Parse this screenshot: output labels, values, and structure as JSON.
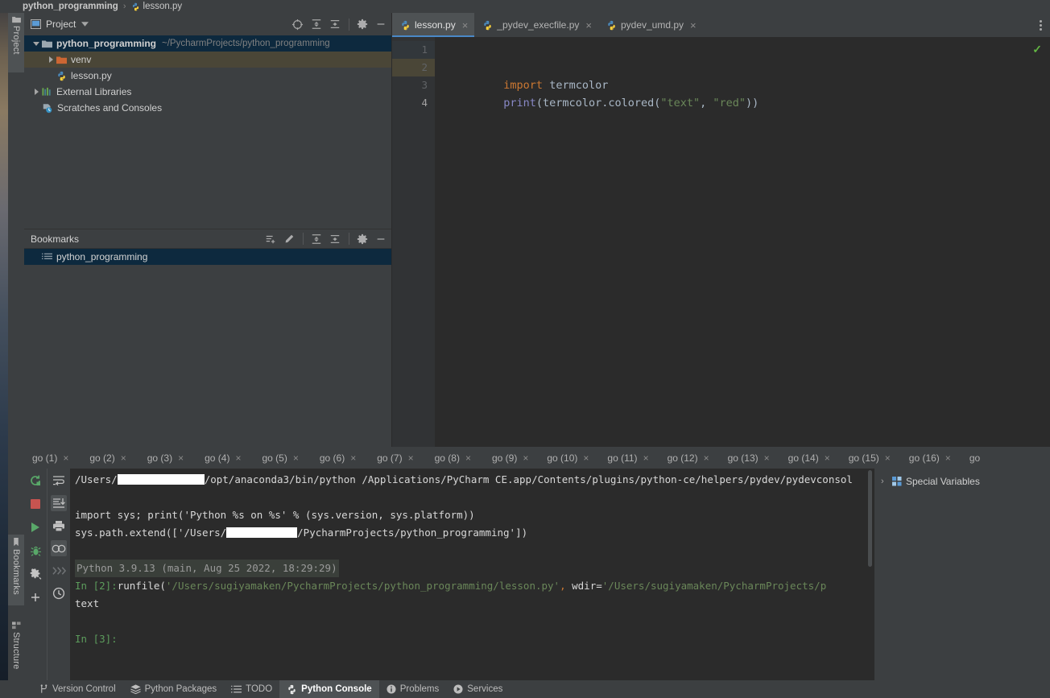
{
  "window": {
    "breadcrumb": {
      "project": "python_programming",
      "separator": "›",
      "file": "lesson.py"
    }
  },
  "left_rail": {
    "items": [
      {
        "label": "Project",
        "icon": "folder-icon",
        "active": true
      },
      {
        "label": "Bookmarks",
        "icon": "bookmark-icon",
        "active": true
      },
      {
        "label": "Structure",
        "icon": "structure-icon",
        "active": false
      }
    ]
  },
  "project_panel": {
    "title": "Project",
    "dropdown_icon": "chevron-down-icon",
    "toolbar_icons": [
      "locate-icon",
      "expand-all-icon",
      "collapse-all-icon",
      "gear-icon",
      "hide-icon"
    ],
    "tree": [
      {
        "name": "python_programming",
        "path": "~/PycharmProjects/python_programming",
        "icon": "folder-icon",
        "expanded": true,
        "selected": "blue",
        "depth": 0
      },
      {
        "name": "venv",
        "path": "",
        "icon": "venv-folder-icon",
        "expanded": false,
        "selected": "olive",
        "depth": 1
      },
      {
        "name": "lesson.py",
        "path": "",
        "icon": "python-file-icon",
        "expanded": null,
        "selected": "",
        "depth": 1
      },
      {
        "name": "External Libraries",
        "path": "",
        "icon": "libraries-icon",
        "expanded": false,
        "selected": "",
        "depth": 0
      },
      {
        "name": "Scratches and Consoles",
        "path": "",
        "icon": "scratches-icon",
        "expanded": null,
        "selected": "",
        "depth": 0
      }
    ]
  },
  "bookmarks_panel": {
    "title": "Bookmarks",
    "toolbar_icons": [
      "add-bookmark-icon",
      "edit-icon",
      "expand-all-icon",
      "collapse-all-icon",
      "gear-icon",
      "hide-icon"
    ],
    "items": [
      {
        "label": "python_programming",
        "icon": "bookmark-list-icon",
        "selected": true
      }
    ]
  },
  "editor": {
    "tabs": [
      {
        "label": "lesson.py",
        "icon": "python-file-icon",
        "active": true,
        "close": "×"
      },
      {
        "label": "_pydev_execfile.py",
        "icon": "python-file-icon",
        "active": false,
        "close": "×"
      },
      {
        "label": "pydev_umd.py",
        "icon": "python-file-icon",
        "active": false,
        "close": "×"
      }
    ],
    "overflow_icon": "more-options-icon",
    "inspection_status": "✓",
    "gutter": [
      "1",
      "2",
      "3",
      "4"
    ],
    "lines": [
      {
        "n": 1,
        "tokens": []
      },
      {
        "n": 2,
        "tokens": [
          {
            "t": "import",
            "c": "kw"
          },
          {
            "t": " termcolor",
            "c": "pl"
          }
        ]
      },
      {
        "n": 3,
        "tokens": [
          {
            "t": "print",
            "c": "fn"
          },
          {
            "t": "(termcolor.colored(",
            "c": "pl"
          },
          {
            "t": "\"text\"",
            "c": "str"
          },
          {
            "t": ", ",
            "c": "pl"
          },
          {
            "t": "\"red\"",
            "c": "str"
          },
          {
            "t": "))",
            "c": "pl"
          }
        ]
      },
      {
        "n": 4,
        "tokens": []
      }
    ]
  },
  "console": {
    "tabs": [
      "go (1)",
      "go (2)",
      "go (3)",
      "go (4)",
      "go (5)",
      "go (6)",
      "go (7)",
      "go (8)",
      "go (9)",
      "go (10)",
      "go (11)",
      "go (12)",
      "go (13)",
      "go (14)",
      "go (15)",
      "go (16)",
      "go"
    ],
    "tab_close_icon": "×",
    "left_toolbar_icons": [
      "rerun-icon",
      "stop-icon",
      "run-icon",
      "debug-icon",
      "settings-icon",
      "add-icon"
    ],
    "right_toolbar_icons": [
      "soft-wrap-icon",
      "scroll-to-end-icon",
      "print-icon",
      "use-console-icon",
      "show-prompt-icon",
      "history-icon"
    ],
    "output": {
      "cmd_prefix": "/Users/",
      "cmd_suffix": "/opt/anaconda3/bin/python /Applications/PyCharm CE.app/Contents/plugins/python-ce/helpers/pydev/pydevconsol",
      "import_line": "import sys; print('Python %s on %s' % (sys.version, sys.platform))",
      "path_prefix": "sys.path.extend(['/Users/",
      "path_suffix": "/PycharmProjects/python_programming'])",
      "banner": "Python 3.9.13 (main, Aug 25 2022, 18:29:29)",
      "in2_prompt": "In [2]:",
      "in2_cmd_a": "runfile(",
      "in2_str_a": "'/Users/sugiyamaken/PycharmProjects/python_programming/lesson.py'",
      "in2_comma": ",",
      "in2_cmd_b": " wdir=",
      "in2_str_b": "'/Users/sugiyamaken/PycharmProjects/p",
      "result": "text",
      "in3_prompt": "In [3]:"
    },
    "variables": {
      "title": "Special Variables",
      "chevron": "›",
      "icon": "variables-icon"
    }
  },
  "statusbar": {
    "items": [
      {
        "label": "Version Control",
        "icon": "branch-icon",
        "active": false
      },
      {
        "label": "Python Packages",
        "icon": "packages-icon",
        "active": false
      },
      {
        "label": "TODO",
        "icon": "todo-icon",
        "active": false
      },
      {
        "label": "Python Console",
        "icon": "python-console-icon",
        "active": true
      },
      {
        "label": "Problems",
        "icon": "problems-icon",
        "active": false
      },
      {
        "label": "Services",
        "icon": "services-icon",
        "active": false
      }
    ]
  },
  "colors": {
    "panel_bg": "#3c3f41",
    "editor_bg": "#2b2b2b",
    "accent_blue": "#4a88c7",
    "selection_blue": "#0d293e",
    "selection_olive": "#4a4637",
    "keyword_orange": "#cc7832",
    "string_green": "#6a8759",
    "function_purple": "#8888c6",
    "ok_green": "#62b543"
  }
}
